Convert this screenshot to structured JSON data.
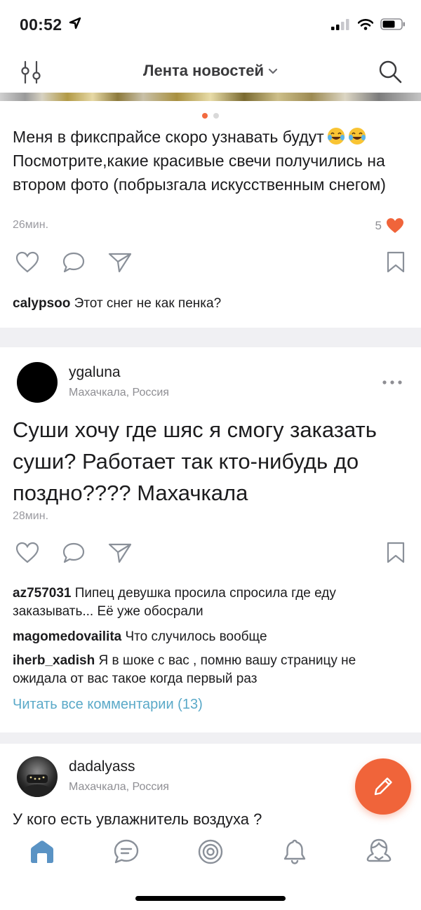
{
  "status_bar": {
    "time": "00:52"
  },
  "header": {
    "title": "Лента новостей"
  },
  "posts": [
    {
      "text_line1": "Меня в фикспрайсе скоро узнавать будут",
      "text_rest": "Посмотрите,какие красивые свечи получились на втором фото (побрызгала искусственным снегом)",
      "time": "26мин.",
      "likes": "5",
      "comments": [
        {
          "user": "calypsoo",
          "text": "Этот снег не как пенка?"
        }
      ]
    },
    {
      "user": "ygaluna",
      "location": "Махачкала, Россия",
      "text": "Суши хочу где шяс я смогу заказать суши? Работает так кто-нибудь до поздно???? Махачкала",
      "time": "28мин.",
      "comments": [
        {
          "user": "az757031",
          "text": "Пипец девушка просила спросила где еду заказывать... Её уже обосрали"
        },
        {
          "user": "magomedovailita",
          "text": "Что случилось вообще"
        },
        {
          "user": "iherb_xadish",
          "text": "Я в шоке с вас , помню вашу страницу не ожидала от вас такое  когда первый раз"
        }
      ],
      "read_all": "Читать все комментарии (13)"
    },
    {
      "user": "dadalyass",
      "location": "Махачкала, Россия",
      "text": "У кого есть увлажнитель воздуха ?"
    }
  ],
  "colors": {
    "accent": "#f0643a",
    "link": "#5aa9c8",
    "muted": "#8e8e93"
  }
}
